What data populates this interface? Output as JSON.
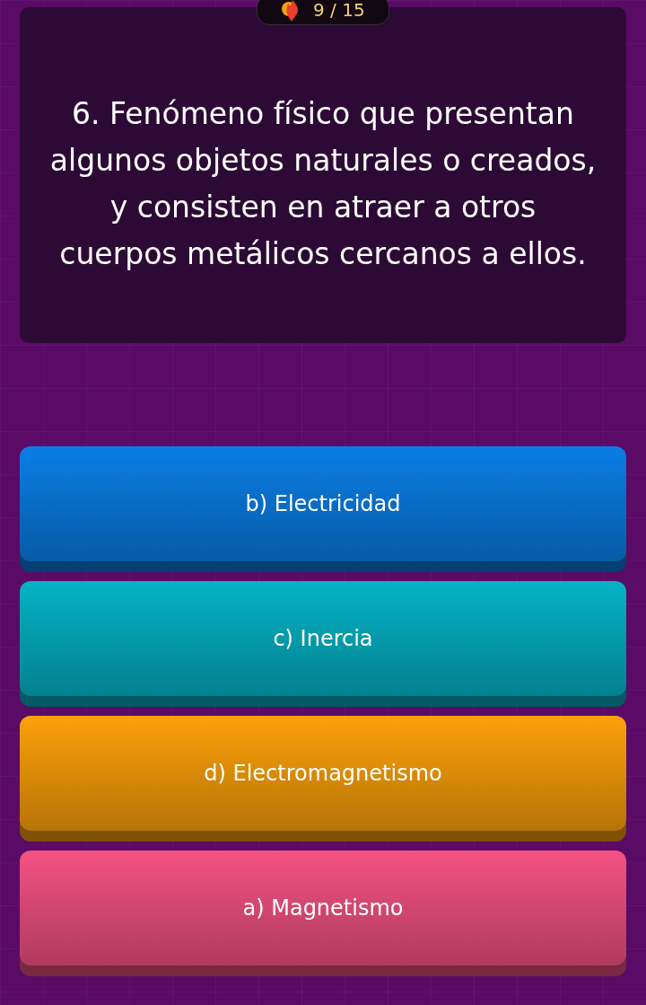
{
  "progress": {
    "counter": "9 / 15"
  },
  "question": {
    "text": "6. Fenómeno físico que presentan algunos objetos naturales o creados, y consisten en atraer a otros cuerpos metálicos cercanos a ellos."
  },
  "options": [
    {
      "label": "b) Electricidad",
      "color": "#0a7ee6"
    },
    {
      "label": "c) Inercia",
      "color": "#05b3c6"
    },
    {
      "label": "d) Electromagnetismo",
      "color": "#fda10a"
    },
    {
      "label": "a) Magnetismo",
      "color": "#f45283"
    }
  ]
}
